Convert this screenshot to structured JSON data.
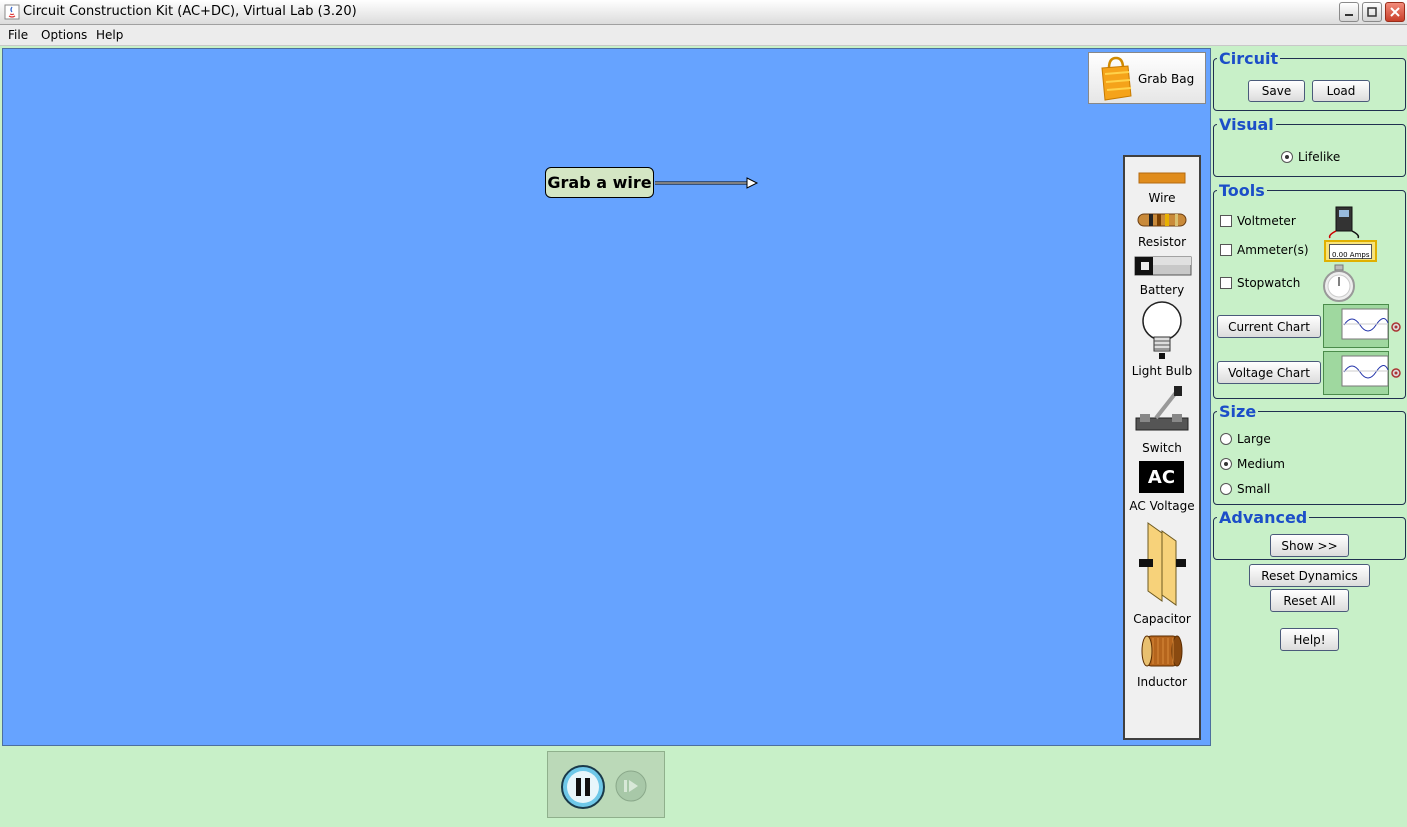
{
  "window": {
    "title": "Circuit Construction Kit (AC+DC), Virtual Lab (3.20)"
  },
  "menu": {
    "items": [
      "File",
      "Options",
      "Help"
    ]
  },
  "canvas": {
    "background": "#66a3ff",
    "hint": "Grab a wire",
    "grab_bag_label": "Grab Bag"
  },
  "toolbox": {
    "items": [
      {
        "label": "Wire",
        "icon": "wire-icon"
      },
      {
        "label": "Resistor",
        "icon": "resistor-icon"
      },
      {
        "label": "Battery",
        "icon": "battery-icon"
      },
      {
        "label": "Light Bulb",
        "icon": "light-bulb-icon"
      },
      {
        "label": "Switch",
        "icon": "switch-icon"
      },
      {
        "label": "AC Voltage",
        "icon": "ac-voltage-icon",
        "badge": "AC"
      },
      {
        "label": "Capacitor",
        "icon": "capacitor-icon"
      },
      {
        "label": "Inductor",
        "icon": "inductor-icon"
      }
    ]
  },
  "side": {
    "circuit": {
      "title": "Circuit",
      "save": "Save",
      "load": "Load"
    },
    "visual": {
      "title": "Visual",
      "option": "Lifelike",
      "selected": true
    },
    "tools": {
      "title": "Tools",
      "voltmeter": "Voltmeter",
      "ammeter": "Ammeter(s)",
      "ammeter_readout": "0.00 Amps",
      "stopwatch": "Stopwatch",
      "current_chart": "Current Chart",
      "voltage_chart": "Voltage Chart"
    },
    "size": {
      "title": "Size",
      "options": [
        "Large",
        "Medium",
        "Small"
      ],
      "selected": "Medium"
    },
    "advanced": {
      "title": "Advanced",
      "show": "Show >>"
    },
    "reset_dynamics": "Reset Dynamics",
    "reset_all": "Reset All",
    "help": "Help!"
  },
  "playback": {
    "pause": "pause-icon",
    "step": "step-icon"
  },
  "colors": {
    "panel_green": "#c8f0c8",
    "group_title": "#1c4ec8",
    "canvas_blue": "#66a3ff"
  }
}
